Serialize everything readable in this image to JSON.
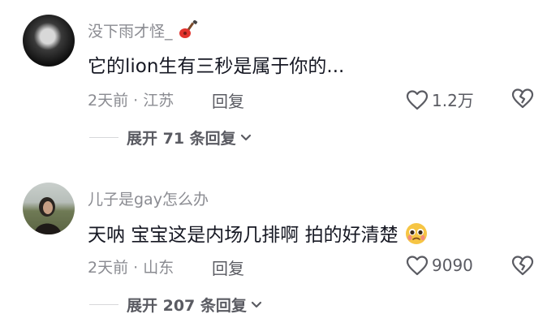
{
  "comments": [
    {
      "username": "没下雨才怪_",
      "content": "它的lion生有三秒是属于你的...",
      "time": "2天前",
      "location": "江苏",
      "reply_label": "回复",
      "likes": "1.2万",
      "expand_label": "展开 71 条回复",
      "username_emoji": "guitar-icon"
    },
    {
      "username": "儿子是gay怎么办",
      "content": "天呐 宝宝这是内场几排啊 拍的好清楚",
      "time": "2天前",
      "location": "山东",
      "reply_label": "回复",
      "likes": "9090",
      "expand_label": "展开 207 条回复",
      "content_emoji": "pleading-face-icon"
    }
  ],
  "separator": "·"
}
